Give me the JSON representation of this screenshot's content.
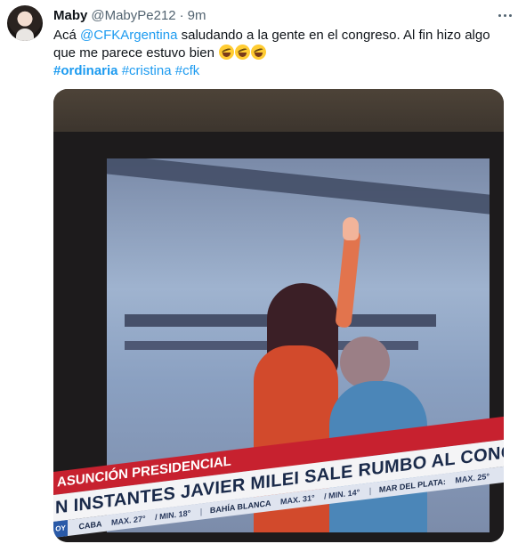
{
  "tweet": {
    "author_name": "Maby",
    "handle": "@MabyPe212",
    "separator": "·",
    "time": "9m",
    "text_before": "Acá ",
    "mention": "@CFKArgentina",
    "text_after": " saludando a la gente en el congreso. Al fin hizo algo que me parece estuvo bien",
    "emojis": [
      "rolling-on-floor-laughing",
      "rolling-on-floor-laughing",
      "rolling-on-floor-laughing"
    ],
    "hashtags": [
      "#ordinaria",
      "#cristina",
      "#cfk"
    ]
  },
  "media": {
    "ticker": {
      "top_label": "ASUNCIÓN PRESIDENCIAL",
      "headline": "N INSTANTES JAVIER MILEI SALE RUMBO AL CONGRESO",
      "side_label": "OY",
      "weather": [
        {
          "city": "CABA",
          "max": "MAX. 27°",
          "min": "/ MIN. 18°"
        },
        {
          "city": "BAHÍA BLANCA",
          "max": "MAX. 31°",
          "min": "/ MIN. 14°"
        },
        {
          "city": "MAR DEL PLATA:",
          "max": "MAX. 25°",
          "min": ""
        }
      ]
    }
  },
  "colors": {
    "link": "#1d9bf0",
    "ticker_red": "#c7212f",
    "text": "#0f1419",
    "secondary": "#536471"
  }
}
